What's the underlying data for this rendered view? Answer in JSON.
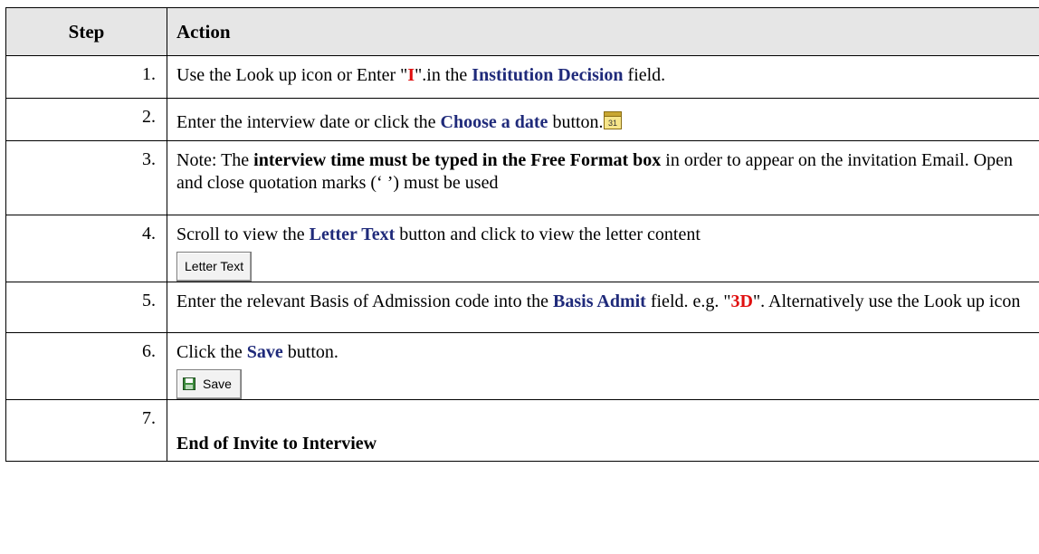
{
  "header": {
    "step": "Step",
    "action": "Action"
  },
  "rows": [
    {
      "step": "1.",
      "parts": [
        {
          "t": "Use the Look up icon or  Enter \""
        },
        {
          "t": "I",
          "red": true
        },
        {
          "t": "\".in the  "
        },
        {
          "t": "Institution Decision",
          "hl": true
        },
        {
          "t": " field."
        }
      ]
    },
    {
      "step": "2.",
      "parts": [
        {
          "t": "Enter the interview date or click the "
        },
        {
          "t": "Choose a date",
          "hl": true
        },
        {
          "t": " button."
        }
      ],
      "calendar_label": "31"
    },
    {
      "step": "3.",
      "parts": [
        {
          "t": "Note: The "
        },
        {
          "t": "interview time must be typed in the Free Format box",
          "b": true
        },
        {
          "t": " in order to appear on the invitation Email.  Open and close quotation marks (‘ ’) must be used"
        }
      ]
    },
    {
      "step": "4.",
      "parts": [
        {
          "t": "Scroll to view the "
        },
        {
          "t": "Letter Text",
          "hl": true
        },
        {
          "t": " button and click to view the letter content"
        }
      ],
      "button_label": "Letter Text"
    },
    {
      "step": "5.",
      "parts": [
        {
          "t": "Enter the relevant Basis of Admission code into the "
        },
        {
          "t": "Basis Admit",
          "hl": true
        },
        {
          "t": " field. e.g. \""
        },
        {
          "t": "3D",
          "red": true
        },
        {
          "t": "\". Alternatively use the Look up icon"
        }
      ]
    },
    {
      "step": "6.",
      "parts": [
        {
          "t": "Click the "
        },
        {
          "t": "Save",
          "hl": true
        },
        {
          "t": " button."
        }
      ],
      "save_label": "Save"
    },
    {
      "step": "7.",
      "end_text": "End of Invite to Interview"
    }
  ],
  "colors": {
    "highlight": "#1f2a7a",
    "red": "#e01010",
    "header_bg": "#e6e6e6"
  },
  "icons": {
    "calendar": "calendar-icon",
    "save": "save-disk-icon"
  }
}
